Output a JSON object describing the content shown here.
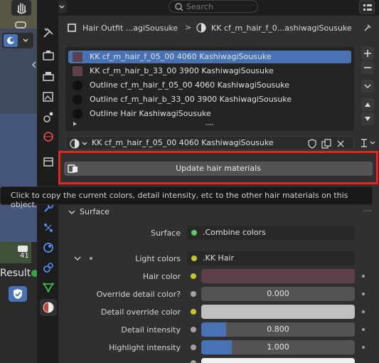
{
  "header": {
    "search_placeholder": "Search"
  },
  "breadcrumb": {
    "object": "Hair Outfit ...agiSousuke",
    "separator": ">",
    "material": "KK cf_m_hair_f_0...ashiwagiSousuke"
  },
  "viewport": {
    "badge": "41",
    "result_text": "Result"
  },
  "material_slots": [
    {
      "label": "KK cf_m_hair_f_05_00 4060 KashiwagiSousuke",
      "selected": true
    },
    {
      "label": "KK cf_m_hair_b_33_00 3900 KashiwagiSousuke",
      "selected": false
    },
    {
      "label": "Outline cf_m_hair_f_05_00 4060 KashiwagiSousuke",
      "selected": false
    },
    {
      "label": "Outline cf_m_hair_b_33_00 3900 KashiwagiSousuke",
      "selected": false
    },
    {
      "label": "Outline Hair KashiwagiSousuke",
      "selected": false
    }
  ],
  "material_selector": {
    "name": "KK cf_m_hair_f_05_00 4060 KashiwagiSousuke"
  },
  "update_button": {
    "label": "Update hair materials"
  },
  "tooltip": {
    "text": "Click to copy the current colors, detail intensity, etc to the other hair materials on this object."
  },
  "surface_panel": {
    "title": "Surface",
    "surface_label": "Surface",
    "surface_value": ".Combine colors",
    "light_colors_label": "Light colors",
    "light_colors_value": ".KK Hair",
    "hair_color_label": "Hair color",
    "override_detail_label": "Override detail color?",
    "override_detail_value": "0.000",
    "detail_override_label": "Detail override color",
    "detail_intensity_label": "Detail intensity",
    "detail_intensity_value": "0.800",
    "detail_intensity_fraction": 0.16,
    "highlight_intensity_label": "Highlight intensity",
    "highlight_intensity_value": "1.000",
    "highlight_intensity_fraction": 0.2
  },
  "colors": {
    "accent": "#4772b3",
    "hair_color": "#5e404c",
    "detail_override_color": "#c0c0c0",
    "highlight_box": "#e8251c"
  }
}
